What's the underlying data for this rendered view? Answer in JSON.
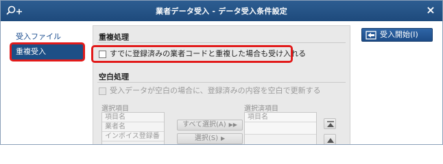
{
  "window": {
    "title": "業者データ受入 - データ受入条件設定",
    "close_glyph": "×"
  },
  "nav": {
    "items": [
      {
        "label": "受入ファイル"
      },
      {
        "label": "重複受入"
      }
    ]
  },
  "duplicate": {
    "section_title": "重複処理",
    "checkbox_label": "すでに登録済みの業者コードと重複した場合も受け入れる"
  },
  "blank": {
    "section_title": "空白処理",
    "checkbox_label": "受入データが空白の場合に、登録済みの内容を空白で更新する"
  },
  "selection": {
    "source_label": "選択項目",
    "source_items": [
      "項目名",
      "業者名",
      "インボイス登録番"
    ],
    "target_label": "選択済項目",
    "target_items": [
      "項目名",
      ""
    ],
    "select_all_label": "すべて選択(A)",
    "select_label": "選択(S)"
  },
  "actions": {
    "start_label": "受入開始(I)"
  },
  "colors": {
    "titlebar": "#1e4a7c",
    "accent": "#1d4f86",
    "highlight": "#e21a1a"
  }
}
